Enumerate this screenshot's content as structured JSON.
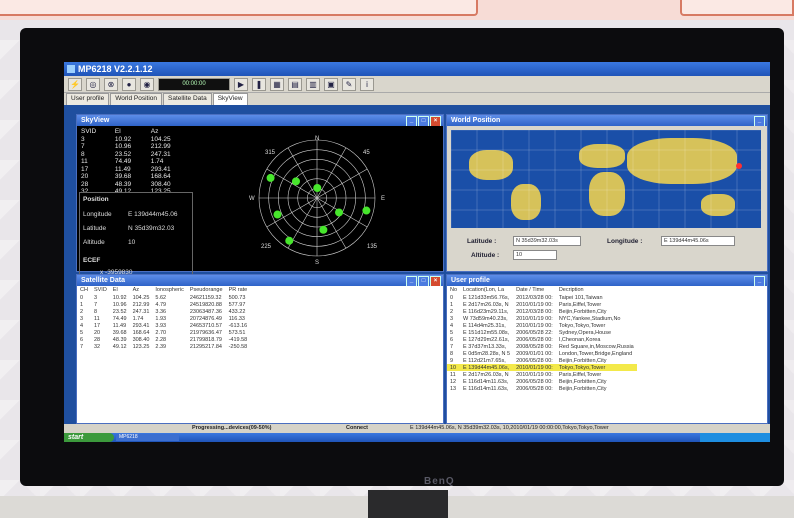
{
  "app": {
    "title": "MP6218 V2.2.1.12",
    "time_display": "00:00:00"
  },
  "tabs": [
    {
      "label": "User profile"
    },
    {
      "label": "World Position"
    },
    {
      "label": "Satellite Data"
    },
    {
      "label": "SkyView"
    }
  ],
  "skyview": {
    "title": "SkyView",
    "columns": [
      "SVID",
      "El",
      "Az"
    ],
    "rows": [
      [
        "3",
        "10.92",
        "104.25"
      ],
      [
        "7",
        "10.96",
        "212.99"
      ],
      [
        "8",
        "23.52",
        "247.31"
      ],
      [
        "11",
        "74.49",
        "1.74"
      ],
      [
        "17",
        "11.49",
        "293.41"
      ],
      [
        "20",
        "39.68",
        "168.64"
      ],
      [
        "28",
        "48.39",
        "308.40"
      ],
      [
        "32",
        "49.12",
        "123.25"
      ]
    ],
    "position_label": "Position",
    "longitude_label": "Longitude",
    "longitude_value": "E 139d44m45.06",
    "latitude_label": "Latitude",
    "latitude_value": "N 35d39m32.03",
    "altitude_label": "Altitude",
    "altitude_value": "10",
    "ecef_label": "ECEF",
    "ecef_value": "x -3959830",
    "compass": {
      "n": "N",
      "w": "W",
      "e": "E",
      "s": "S",
      "a315": "315",
      "a45": "45",
      "a225": "225",
      "a135": "135"
    }
  },
  "world": {
    "title": "World Position",
    "latitude_label": "Latitude :",
    "latitude_value": "N 35d39m32.03s",
    "longitude_label": "Longitude :",
    "longitude_value": "E 139d44m45.06s",
    "altitude_label": "Altitude :",
    "altitude_value": "10"
  },
  "satdata": {
    "title": "Satellite Data",
    "columns": [
      "CH",
      "SVID",
      "El",
      "Az",
      "Ionospheric",
      "Pseudorange",
      "PR rate"
    ],
    "rows": [
      [
        "0",
        "3",
        "10.92",
        "104.25",
        "5.62",
        "24621159.32",
        "500.73"
      ],
      [
        "1",
        "7",
        "10.96",
        "212.99",
        "4.79",
        "24519820.88",
        "577.97"
      ],
      [
        "2",
        "8",
        "23.52",
        "247.31",
        "3.36",
        "23063487.36",
        "433.22"
      ],
      [
        "3",
        "11",
        "74.49",
        "1.74",
        "1.93",
        "20724876.49",
        "116.33"
      ],
      [
        "4",
        "17",
        "11.49",
        "293.41",
        "3.93",
        "24653710.57",
        "-613.16"
      ],
      [
        "5",
        "20",
        "39.68",
        "168.64",
        "2.70",
        "21979636.47",
        "573.51"
      ],
      [
        "6",
        "28",
        "48.39",
        "308.40",
        "2.28",
        "21799818.79",
        "-419.58"
      ],
      [
        "7",
        "32",
        "49.12",
        "123.25",
        "2.39",
        "21295217.84",
        "-250.58"
      ]
    ]
  },
  "profile": {
    "title": "User profile",
    "columns": [
      "No",
      "Location(Lon, La",
      "Date / Time",
      "Decription"
    ],
    "rows": [
      [
        "0",
        "E 121d33m56.76s,",
        "2012/03/28 00:",
        "Taipei 101,Taiwan"
      ],
      [
        "1",
        "E 2d17m26.03s, N",
        "2010/01/19 00:",
        "Paris,Eiffel,Tower"
      ],
      [
        "2",
        "E 116d23m29.11s,",
        "2012/03/28 00:",
        "Beijin,Forbitten,City"
      ],
      [
        "3",
        "W 73d59m40.23s,",
        "2010/01/19 00:",
        "NYC,Yankee,Stadium,No"
      ],
      [
        "4",
        "E 114d4m25.31s,",
        "2010/01/19 00:",
        "Tokyo,Tokyo,Tower"
      ],
      [
        "5",
        "E 151d12m55.08s,",
        "2006/05/28 22:",
        "Sydney,Opera,House"
      ],
      [
        "6",
        "E 127d29m22.61s,",
        "2006/05/28 00:",
        "I,Cheonan,Korea"
      ],
      [
        "7",
        "E 37d37m13.33s,",
        "2008/05/28 00:",
        "Red Square,in,Moscow,Russia"
      ],
      [
        "8",
        "E 0d5m28.28s, N 5",
        "2009/01/01 00:",
        "London,Tower,Bridge,England"
      ],
      [
        "9",
        "E 112d21m7.65s,",
        "2006/05/28 00:",
        "Beijin,Forbitten,City"
      ],
      [
        "10",
        "E 139d44m45.06s,",
        "2010/01/19 00:",
        "Tokyo,Tokyo,Tower"
      ],
      [
        "11",
        "E 2d17m26.03s, N",
        "2010/01/19 00:",
        "Paris,Eiffel,Tower"
      ],
      [
        "12",
        "E 116d14m11.63s,",
        "2006/05/28 00:",
        "Beijin,Forbitten,City"
      ],
      [
        "13",
        "E 116d14m11.63s,",
        "2006/05/28 00:",
        "Beijin,Forbitten,City"
      ]
    ],
    "selected_row": 10
  },
  "status": {
    "progress_label": "Progressing...devices(09-50%)",
    "connect_label": "Connect",
    "message": "E 139d44m45.06s, N 35d39m32.03s, 10,2010/01/19 00:00:00,Tokyo,Tokyo,Tower"
  },
  "taskbar": {
    "start_label": "start",
    "task_label": "MP6218"
  },
  "monitor": {
    "brand": "BenQ"
  },
  "colors": {
    "window_title": "#2f63c8",
    "sky_bg": "#000000",
    "sat_marker": "#47e62c",
    "map_ocean": "#1a4fa8",
    "map_land": "#d6c25a",
    "selection": "#f3e94a"
  }
}
